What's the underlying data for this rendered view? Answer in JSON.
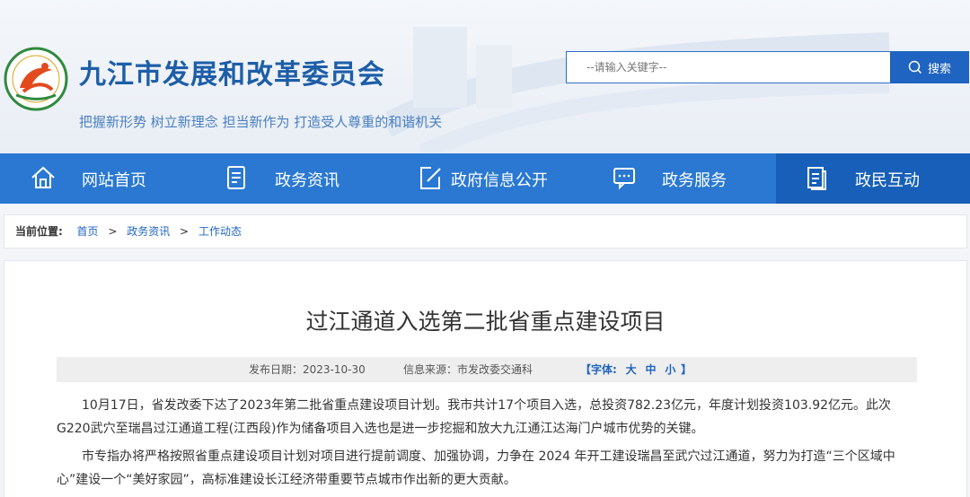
{
  "header": {
    "site_title": "九江市发展和改革委员会",
    "slogan": "把握新形势 树立新理念 担当新作为 打造受人尊重的和谐机关",
    "logo_text": "九江市发展和改革委员会",
    "search": {
      "placeholder": "--请输入关键字--",
      "button_label": "搜索"
    }
  },
  "nav": {
    "items": [
      {
        "label": "网站首页",
        "icon": "home-icon"
      },
      {
        "label": "政务资讯",
        "icon": "document-list-icon"
      },
      {
        "label": "政府信息公开",
        "icon": "edit-icon"
      },
      {
        "label": "政务服务",
        "icon": "chat-icon"
      },
      {
        "label": "政民互动",
        "icon": "clipboard-icon"
      }
    ],
    "active_index": 4
  },
  "breadcrumb": {
    "label": "当前位置:",
    "items": [
      "首页",
      "政务资讯",
      "工作动态"
    ],
    "separator": ">"
  },
  "article": {
    "title": "过江通道入选第二批省重点建设项目",
    "publish_date": "发布日期：2023-10-30",
    "source": "信息来源：市发改委交通科",
    "font_size_prefix": "【字体:",
    "font_size_options": [
      "大",
      "中",
      "小"
    ],
    "font_size_suffix": "】",
    "paragraphs": [
      "10月17日，省发改委下达了2023年第二批省重点建设项目计划。我市共计17个项目入选，总投资782.23亿元，年度计划投资103.92亿元。此次G220武穴至瑞昌过江通道工程(江西段)作为储备项目入选也是进一步挖掘和放大九江通江达海门户城市优势的关键。",
      "市专指办将严格按照省重点建设项目计划对项目进行提前调度、加强协调，力争在 2024 年开工建设瑞昌至武穴过江通道，努力为打造“三个区域中心”建设一个“美好家园”，高标准建设长江经济带重要节点城市作出新的更大贡献。"
    ]
  },
  "colors": {
    "brand_blue": "#1d5ea8",
    "nav_blue": "#2a78d2",
    "nav_active": "#175fb8",
    "link_blue": "#1f64c0"
  }
}
